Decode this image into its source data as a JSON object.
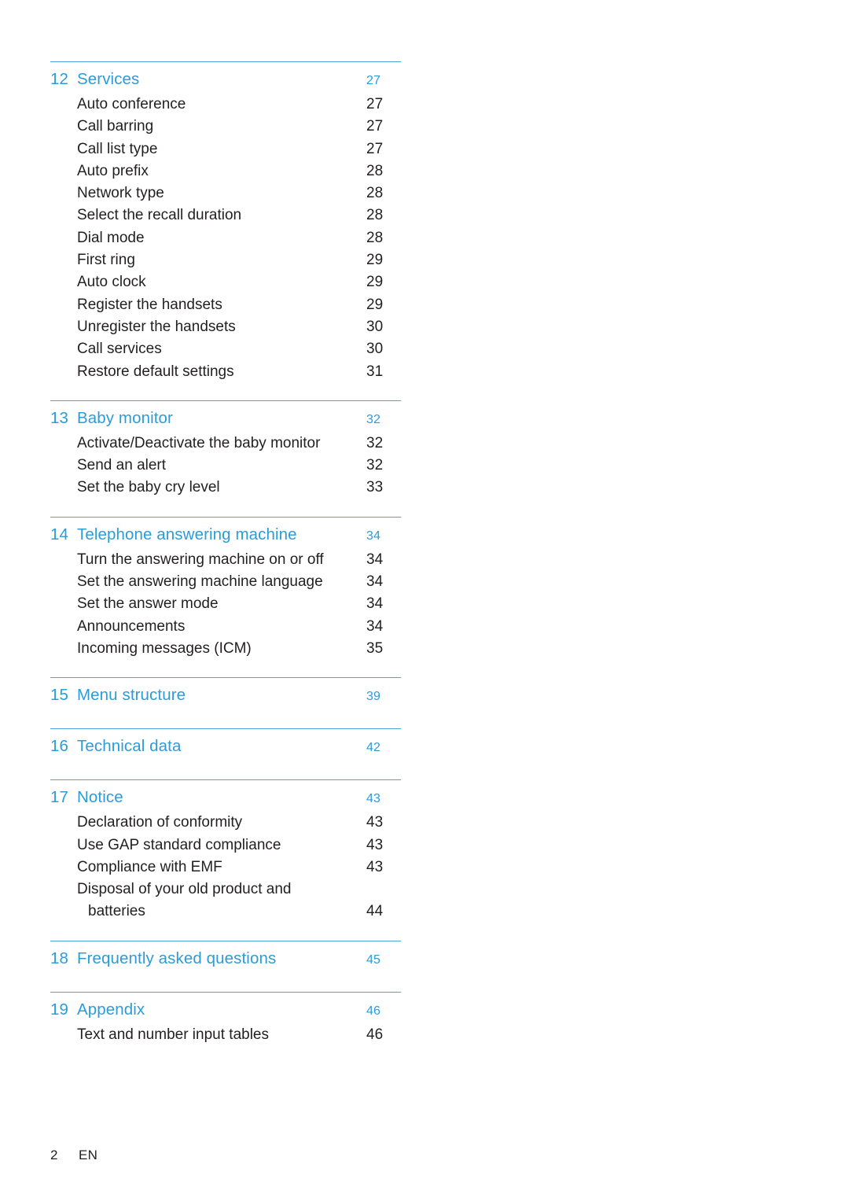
{
  "document": {
    "footer_page_number": "2",
    "footer_language": "EN",
    "accent_color": "#2b9cd8",
    "rule_color": "#4aa5dc"
  },
  "toc": {
    "chapters": [
      {
        "number": "12",
        "title": "Services",
        "page": "27",
        "entries": [
          {
            "label": "Auto conference",
            "page": "27"
          },
          {
            "label": "Call barring",
            "page": "27"
          },
          {
            "label": "Call list type",
            "page": "27"
          },
          {
            "label": "Auto prefix",
            "page": "28"
          },
          {
            "label": "Network type",
            "page": "28"
          },
          {
            "label": "Select the recall duration",
            "page": "28"
          },
          {
            "label": "Dial mode",
            "page": "28"
          },
          {
            "label": "First ring",
            "page": "29"
          },
          {
            "label": "Auto clock",
            "page": "29"
          },
          {
            "label": "Register the handsets",
            "page": "29"
          },
          {
            "label": "Unregister the handsets",
            "page": "30"
          },
          {
            "label": "Call services",
            "page": "30"
          },
          {
            "label": "Restore default settings",
            "page": "31"
          }
        ]
      },
      {
        "number": "13",
        "title": "Baby monitor",
        "page": "32",
        "entries": [
          {
            "label": "Activate/Deactivate the baby monitor",
            "page": "32"
          },
          {
            "label": "Send an alert",
            "page": "32"
          },
          {
            "label": "Set the baby cry level",
            "page": "33"
          }
        ]
      },
      {
        "number": "14",
        "title": "Telephone answering machine",
        "page": "34",
        "entries": [
          {
            "label": "Turn the answering machine on or off",
            "page": "34"
          },
          {
            "label": "Set the answering machine language",
            "page": "34"
          },
          {
            "label": "Set the answer mode",
            "page": "34"
          },
          {
            "label": "Announcements",
            "page": "34"
          },
          {
            "label": "Incoming messages (ICM)",
            "page": "35"
          }
        ]
      },
      {
        "number": "15",
        "title": "Menu structure",
        "page": "39",
        "entries": []
      },
      {
        "number": "16",
        "title": "Technical data",
        "page": "42",
        "entries": []
      },
      {
        "number": "17",
        "title": "Notice",
        "page": "43",
        "entries": [
          {
            "label": "Declaration of conformity",
            "page": "43"
          },
          {
            "label": "Use GAP standard compliance",
            "page": "43"
          },
          {
            "label": "Compliance with EMF",
            "page": "43"
          },
          {
            "label": "Disposal of your old product and",
            "page": ""
          },
          {
            "label": "batteries",
            "page": "44",
            "indent": 2
          }
        ]
      },
      {
        "number": "18",
        "title": "Frequently asked questions",
        "page": "45",
        "entries": []
      },
      {
        "number": "19",
        "title": "Appendix",
        "page": "46",
        "entries": [
          {
            "label": "Text and number input tables",
            "page": "46"
          }
        ]
      }
    ]
  }
}
